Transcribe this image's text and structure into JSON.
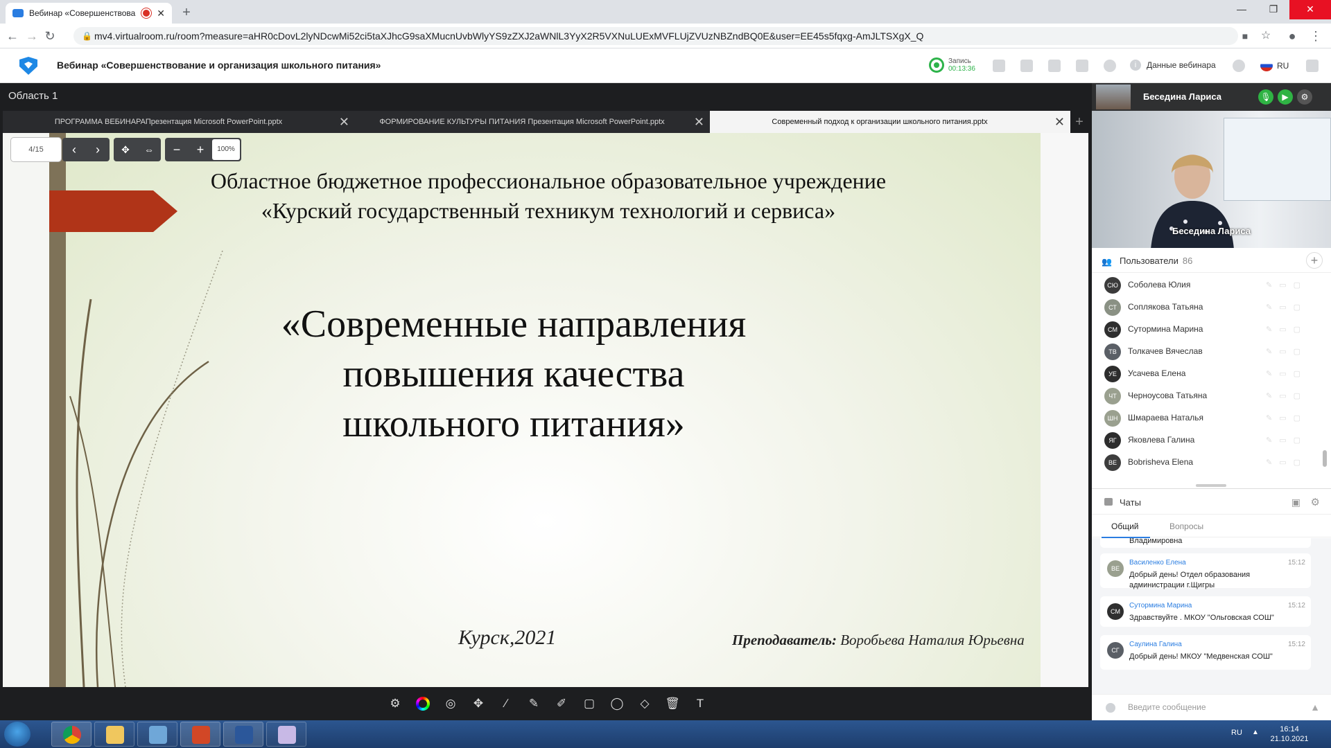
{
  "browser": {
    "tab_title": "Вебинар «Совершенствова",
    "url": "mv4.virtualroom.ru/room?measure=aHR0cDovL2lyNDcwMi52ci5taXJhcG9saXMucnUvbWlyYS9zZXJ2aWNlL3YyX2R5VXNuLUExMVFLUjZVUzNBZndBQ0E&user=EE45s5fqxg-AmJLTSXgX_Q"
  },
  "app": {
    "title": "Вебинар «Совершенствование и организация школьного питания»",
    "record_label": "Запись",
    "record_time": "00:13:36",
    "webinar_data_label": "Данные вебинара",
    "lang": "RU"
  },
  "area": {
    "title": "Область 1"
  },
  "doc_tabs": [
    {
      "label": "ПРОГРАММА ВЕБИНАРАПрезентация Microsoft PowerPoint.pptx",
      "active": false
    },
    {
      "label": "ФОРМИРОВАНИЕ КУЛЬТУРЫ ПИТАНИЯ Презентация Microsoft PowerPoint.pptx",
      "active": false
    },
    {
      "label": "Современный подход к организации школьного питания.pptx",
      "active": true
    }
  ],
  "slide_toolbar": {
    "page": "4/15",
    "zoom": "100%"
  },
  "slide": {
    "org": "Областное бюджетное профессиональное образовательное учреждение «Курский государственный техникум технологий и сервиса»",
    "title": "«Современные направления повышения качества школьного питания»",
    "city_year": "Курск,2021",
    "teacher_label": "Преподаватель:",
    "teacher_name": "Воробьева Наталия Юрьевна"
  },
  "speaker": {
    "name": "Беседина Лариса"
  },
  "users": {
    "title": "Пользователи",
    "count": "86",
    "items": [
      {
        "initials": "СЮ",
        "name": "Соболева Юлия",
        "color": "#3b3b3b"
      },
      {
        "initials": "СТ",
        "name": "Соплякова Татьяна",
        "color": "#8a9184"
      },
      {
        "initials": "СМ",
        "name": "Сутормина Марина",
        "color": "#2f2f2f"
      },
      {
        "initials": "ТВ",
        "name": "Толкачев Вячеслав",
        "color": "#5a5f66"
      },
      {
        "initials": "УЕ",
        "name": "Усачева Елена",
        "color": "#2d2d2d"
      },
      {
        "initials": "ЧТ",
        "name": "Черноусова Татьяна",
        "color": "#9aa08f"
      },
      {
        "initials": "ШН",
        "name": "Шмараева Наталья",
        "color": "#9aa08f"
      },
      {
        "initials": "ЯГ",
        "name": "Яковлева Галина",
        "color": "#2d2d2d"
      },
      {
        "initials": "BE",
        "name": "Bobrisheva Elena",
        "color": "#3d3d3d"
      }
    ]
  },
  "chat": {
    "title": "Чаты",
    "tab_general": "Общий",
    "tab_questions": "Вопросы",
    "partial_text": "Владимировна",
    "messages": [
      {
        "initials": "ВЕ",
        "author": "Василенко Елена",
        "time": "15:12",
        "text": "Добрый день! Отдел образования администрации г.Щигры",
        "color": "#9aa08f"
      },
      {
        "initials": "СМ",
        "author": "Сутормина Марина",
        "time": "15:12",
        "text": "Здравствуйте . МКОУ \"Ольговская СОШ\"",
        "color": "#2f2f2f"
      },
      {
        "initials": "СГ",
        "author": "Саулина Галина",
        "time": "15:12",
        "text": "Добрый день! МКОУ \"Медвенская СОШ\"",
        "color": "#5a5f66"
      }
    ],
    "input_placeholder": "Введите сообщение"
  },
  "taskbar": {
    "lang": "RU",
    "time": "16:14",
    "date": "21.10.2021"
  }
}
